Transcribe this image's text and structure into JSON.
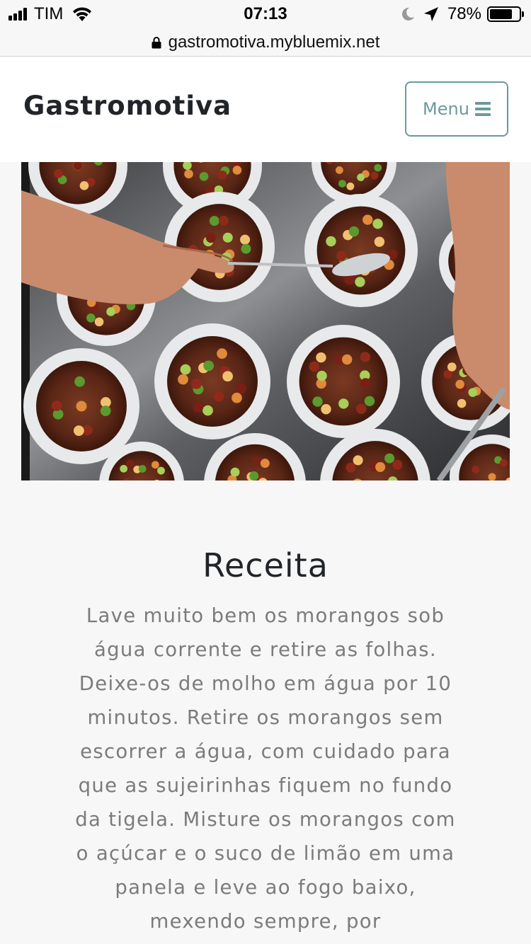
{
  "status_bar": {
    "carrier": "TIM",
    "time": "07:13",
    "battery_percent": "78%",
    "battery_level": 0.78,
    "signal_bars": 4,
    "icons": [
      "signal-icon",
      "wifi-icon",
      "moon-icon",
      "location-arrow-icon",
      "battery-icon"
    ]
  },
  "browser": {
    "url": "gastromotiva.mybluemix.net",
    "secure_icon": "lock-icon"
  },
  "navbar": {
    "brand": "Gastromotiva",
    "menu_label": "Menu",
    "menu_icon": "bars-icon",
    "accent_color": "#6a9a9b"
  },
  "hero": {
    "image_subject": "bowls-of-bean-stew-photo"
  },
  "content": {
    "title": "Receita",
    "body": "Lave muito bem os morangos sob água corrente e retire as folhas. Deixe-os de molho em água por 10 minutos. Retire os morangos sem escorrer a água, com cuidado para que as sujeirinhas fiquem no fundo da tigela. Misture os morangos com o açúcar e o suco de limão em uma panela e leve ao fogo baixo, mexendo sempre, por"
  }
}
